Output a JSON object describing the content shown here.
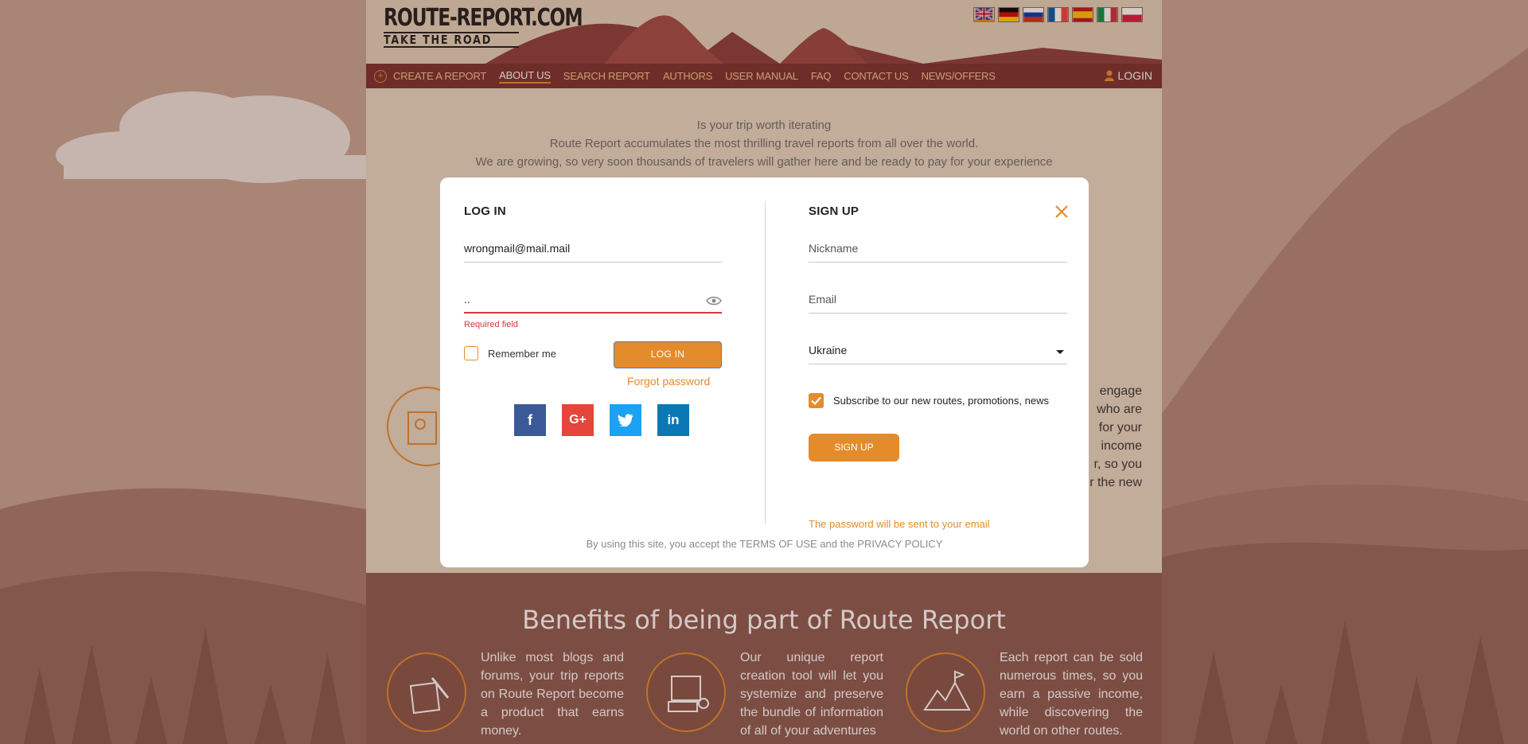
{
  "header": {
    "logo_line1": "ROUTE-REPORT.COM",
    "logo_line2": "TAKE THE ROAD",
    "flags": [
      "gb-flag",
      "de-flag",
      "ru-flag",
      "fr-flag",
      "es-flag",
      "it-flag",
      "pl-flag"
    ],
    "login_label": "LOGIN"
  },
  "nav": {
    "items": [
      "CREATE A REPORT",
      "ABOUT US",
      "SEARCH REPORT",
      "AUTHORS",
      "USER MANUAL",
      "FAQ",
      "CONTACT US",
      "NEWS/OFFERS"
    ],
    "active_index": 1
  },
  "intro": {
    "line1": "Is your trip worth iterating",
    "line2": "Route Report accumulates the most thrilling travel reports from all over the world.",
    "line3": "We are growing, so very soon thousands of travelers will gather here and be ready to pay for your experience"
  },
  "side_text": {
    "lines": [
      "engage",
      "who are",
      "for your",
      "income",
      "r, so you",
      "r the new"
    ]
  },
  "benefits": {
    "title": "Benefits of being part of Route Report",
    "items": [
      {
        "text": "Unlike most blogs and forums, your trip reports on Route Report become a product that earns money."
      },
      {
        "text": "Our unique report creation tool will let you systemize and preserve the bundle of information of all of your adventures"
      },
      {
        "text": "Each report can be sold numerous times, so you earn a passive income, while discovering the world on other routes."
      }
    ]
  },
  "modal": {
    "login": {
      "title": "LOG IN",
      "email_value": "wrongmail@mail.mail",
      "password_value": "..",
      "error": "Required field",
      "remember_label": "Remember me",
      "button": "LOG IN",
      "forgot": "Forgot password"
    },
    "signup": {
      "title": "SIGN UP",
      "nickname_placeholder": "Nickname",
      "email_placeholder": "Email",
      "country_value": "Ukraine",
      "subscribe_label": "Subscribe to our new routes, promotions, news",
      "button": "SIGN UP",
      "password_note": "The password will be sent to your email"
    },
    "terms": "By using this site, you accept the TERMS OF USE and the PRIVACY POLICY"
  },
  "colors": {
    "accent": "#e48b2b",
    "nav_bg": "#7a2f2d",
    "error": "#d23c3c",
    "facebook": "#3b5998",
    "google": "#e5453a",
    "twitter": "#1da1f2",
    "linkedin": "#0a78b5"
  }
}
